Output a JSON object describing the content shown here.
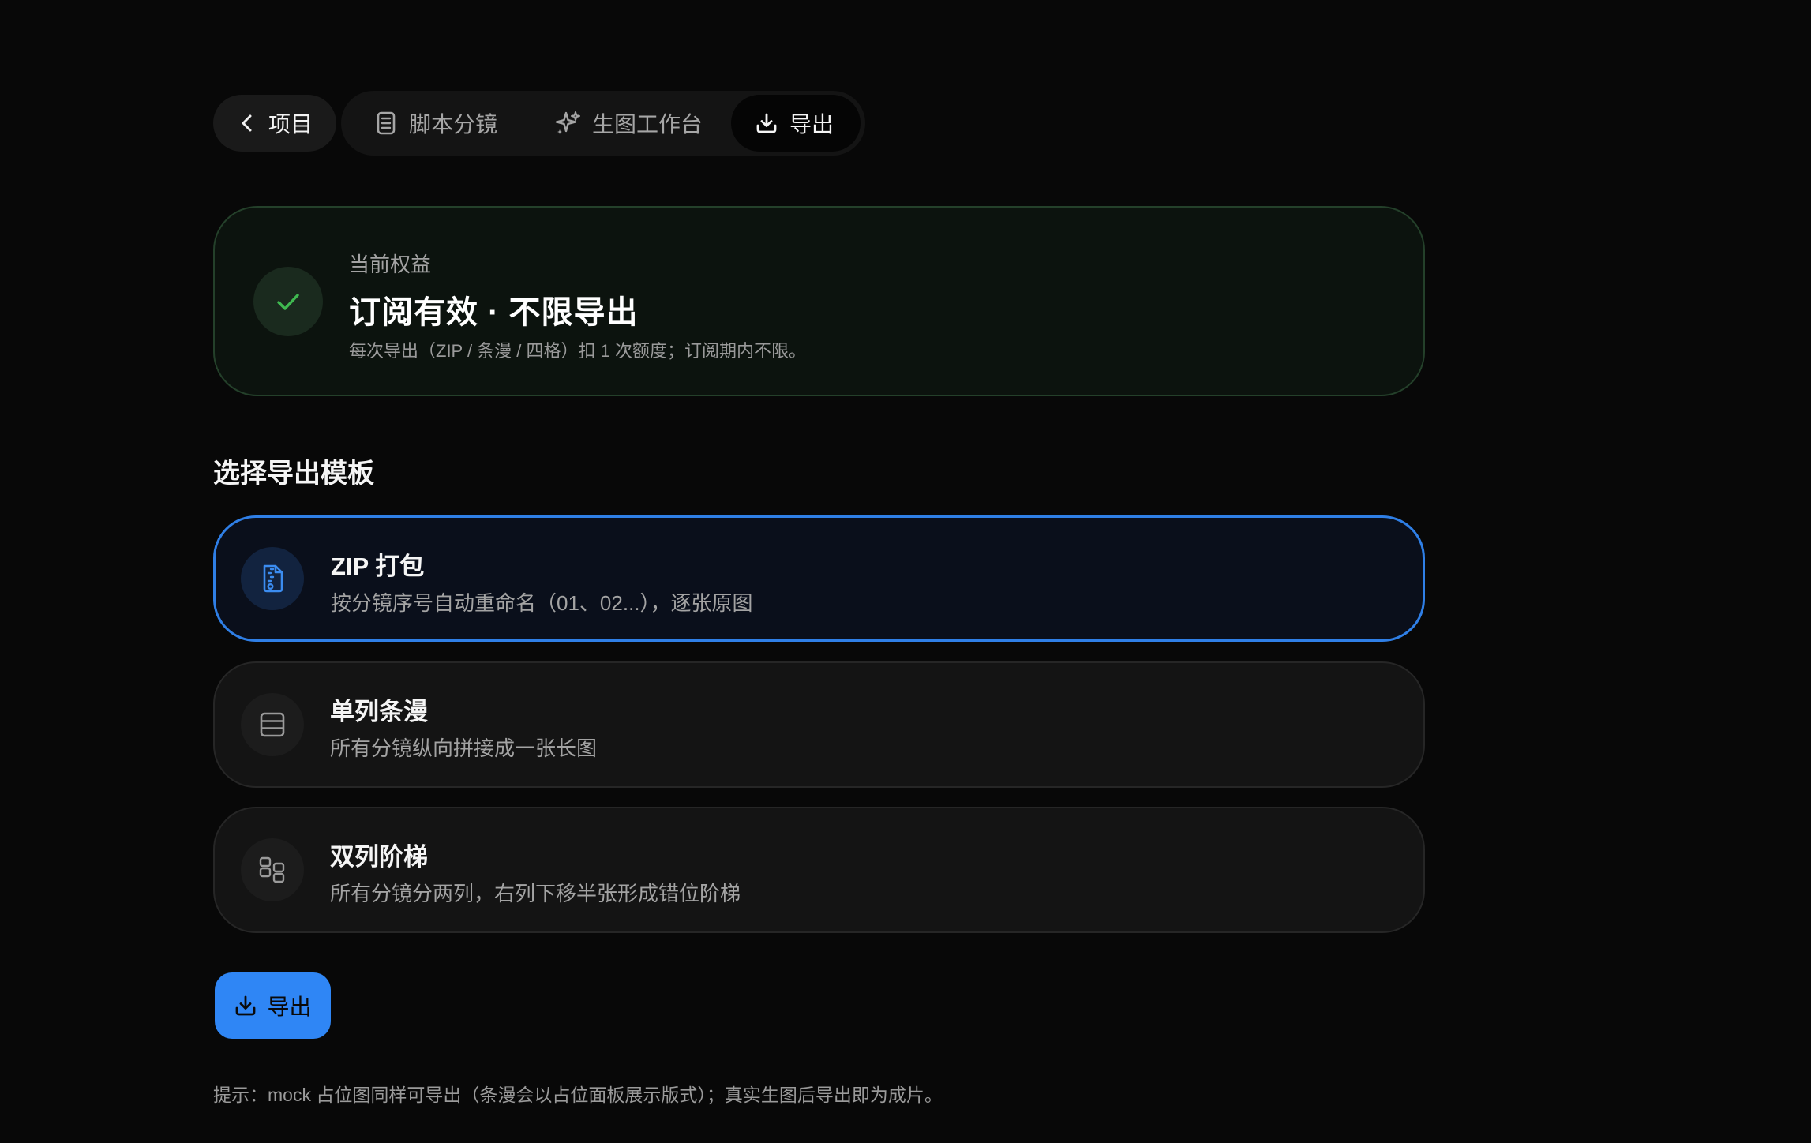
{
  "nav": {
    "back_label": "项目",
    "tabs": [
      {
        "label": "脚本分镜",
        "icon": "script-list-icon",
        "active": false
      },
      {
        "label": "生图工作台",
        "icon": "sparkle-icon",
        "active": false
      },
      {
        "label": "导出",
        "icon": "download-icon",
        "active": true
      }
    ]
  },
  "subscription": {
    "kicker": "当前权益",
    "title": "订阅有效 · 不限导出",
    "description": "每次导出（ZIP / 条漫 / 四格）扣 1 次额度；订阅期内不限。",
    "icon": "check-icon"
  },
  "section_title": "选择导出模板",
  "templates": [
    {
      "title": "ZIP 打包",
      "description": "按分镜序号自动重命名（01、02...），逐张原图",
      "icon": "zip-file-icon",
      "selected": true
    },
    {
      "title": "单列条漫",
      "description": "所有分镜纵向拼接成一张长图",
      "icon": "single-column-icon",
      "selected": false
    },
    {
      "title": "双列阶梯",
      "description": "所有分镜分两列，右列下移半张形成错位阶梯",
      "icon": "two-column-stagger-icon",
      "selected": false
    }
  ],
  "export_button": {
    "label": "导出",
    "icon": "download-icon"
  },
  "hint": "提示：mock 占位图同样可导出（条漫会以占位面板展示版式）；真实生图后导出即为成片。",
  "colors": {
    "background": "#080808",
    "accent": "#2f86f5",
    "success": "#3fb950",
    "selected_border": "#2f7fe6"
  }
}
